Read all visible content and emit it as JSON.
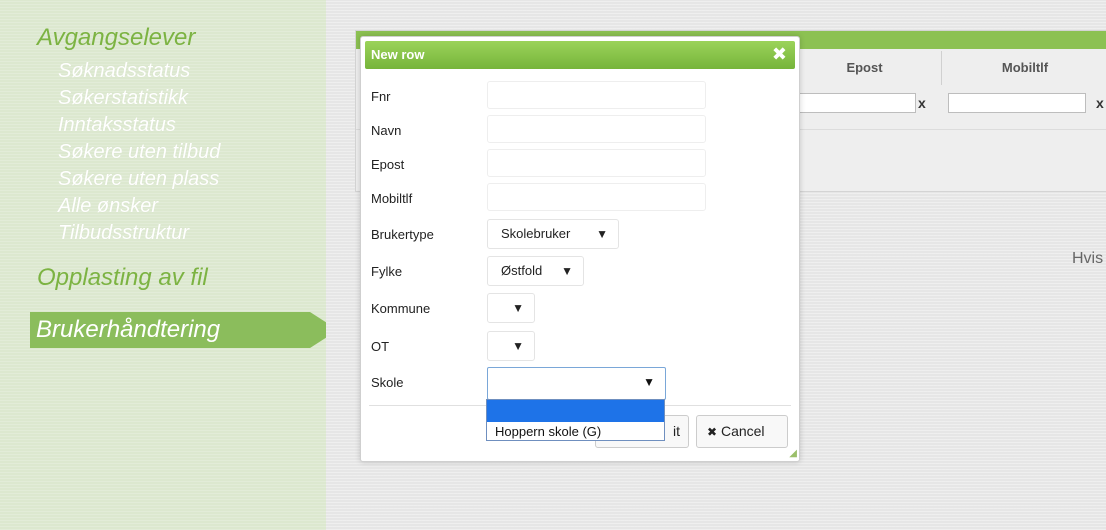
{
  "sidebar": {
    "main_heading": "Avgangselever",
    "sub_items": [
      {
        "label": "Søknadsstatus"
      },
      {
        "label": "Søkerstatistikk"
      },
      {
        "label": "Inntaksstatus"
      },
      {
        "label": "Søkere uten tilbud"
      },
      {
        "label": "Søkere uten plass"
      },
      {
        "label": "Alle ønsker"
      },
      {
        "label": "Tilbudsstruktur"
      }
    ],
    "upload_heading": "Opplasting av fil",
    "active_item": "Brukerhåndtering"
  },
  "grid": {
    "columns": [
      {
        "label": "Epost"
      },
      {
        "label": "Mobiltlf"
      }
    ],
    "clear_label": "x",
    "side_text": "Hvis"
  },
  "dialog": {
    "title": "New row",
    "close_icon": "close-icon",
    "fields": {
      "fnr": {
        "label": "Fnr",
        "value": ""
      },
      "navn": {
        "label": "Navn",
        "value": ""
      },
      "epost": {
        "label": "Epost",
        "value": ""
      },
      "mobiltlf": {
        "label": "Mobiltlf",
        "value": ""
      },
      "brukertype": {
        "label": "Brukertype",
        "value": "Skolebruker"
      },
      "fylke": {
        "label": "Fylke",
        "value": "Østfold"
      },
      "kommune": {
        "label": "Kommune",
        "value": ""
      },
      "ot": {
        "label": "OT",
        "value": ""
      },
      "skole": {
        "label": "Skole",
        "value": ""
      }
    },
    "skole_options": [
      "",
      "Hoppern skole (G)"
    ],
    "submit_label_visible": "it",
    "cancel_label": "Cancel"
  },
  "colors": {
    "accent_green": "#7cb342",
    "titlebar_green": "#8cc152",
    "selected_blue": "#1e73e8"
  }
}
